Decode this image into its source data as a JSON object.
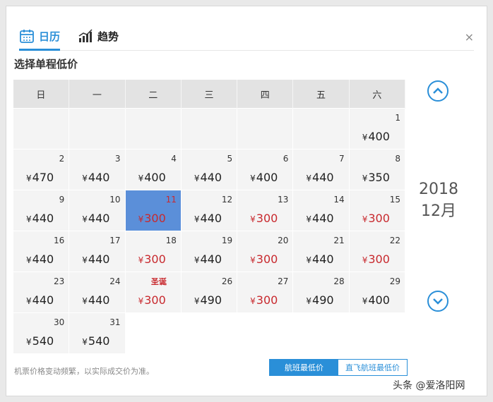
{
  "tabs": [
    {
      "label": "日历",
      "icon": "calendar-icon",
      "active": true
    },
    {
      "label": "趋势",
      "icon": "trend-chart-icon",
      "active": false
    }
  ],
  "close_label": "×",
  "subtitle": "选择单程低价",
  "weekdays": [
    "日",
    "一",
    "二",
    "三",
    "四",
    "五",
    "六"
  ],
  "currency": "¥",
  "weeks": [
    [
      null,
      null,
      null,
      null,
      null,
      null,
      {
        "day": "1",
        "price": "400"
      }
    ],
    [
      {
        "day": "2",
        "price": "470"
      },
      {
        "day": "3",
        "price": "440"
      },
      {
        "day": "4",
        "price": "400"
      },
      {
        "day": "5",
        "price": "440"
      },
      {
        "day": "6",
        "price": "400"
      },
      {
        "day": "7",
        "price": "440"
      },
      {
        "day": "8",
        "price": "350"
      }
    ],
    [
      {
        "day": "9",
        "price": "440"
      },
      {
        "day": "10",
        "price": "440"
      },
      {
        "day": "11",
        "price": "300",
        "low": true,
        "selected": true
      },
      {
        "day": "12",
        "price": "440"
      },
      {
        "day": "13",
        "price": "300",
        "low": true
      },
      {
        "day": "14",
        "price": "440"
      },
      {
        "day": "15",
        "price": "300",
        "low": true
      }
    ],
    [
      {
        "day": "16",
        "price": "440"
      },
      {
        "day": "17",
        "price": "440"
      },
      {
        "day": "18",
        "price": "300",
        "low": true
      },
      {
        "day": "19",
        "price": "440"
      },
      {
        "day": "20",
        "price": "300",
        "low": true
      },
      {
        "day": "21",
        "price": "440"
      },
      {
        "day": "22",
        "price": "300",
        "low": true
      }
    ],
    [
      {
        "day": "23",
        "price": "440"
      },
      {
        "day": "24",
        "price": "440"
      },
      {
        "day": "",
        "holiday": "圣诞",
        "price": "300",
        "low": true
      },
      {
        "day": "26",
        "price": "490"
      },
      {
        "day": "27",
        "price": "300",
        "low": true
      },
      {
        "day": "28",
        "price": "490"
      },
      {
        "day": "29",
        "price": "400"
      }
    ],
    [
      {
        "day": "30",
        "price": "540"
      },
      {
        "day": "31",
        "price": "540"
      },
      "none",
      "none",
      "none",
      "none",
      "none"
    ]
  ],
  "year": "2018",
  "month": "12月",
  "note": "机票价格变动频繁，以实际成交价为准。",
  "toggle": {
    "option1": "航班最低价",
    "option2": "直飞航班最低价"
  },
  "watermark": "头条 @爱洛阳网",
  "colors": {
    "accent": "#2a8fd8",
    "low_price": "#c8292e",
    "selected": "#5b8fd9"
  }
}
